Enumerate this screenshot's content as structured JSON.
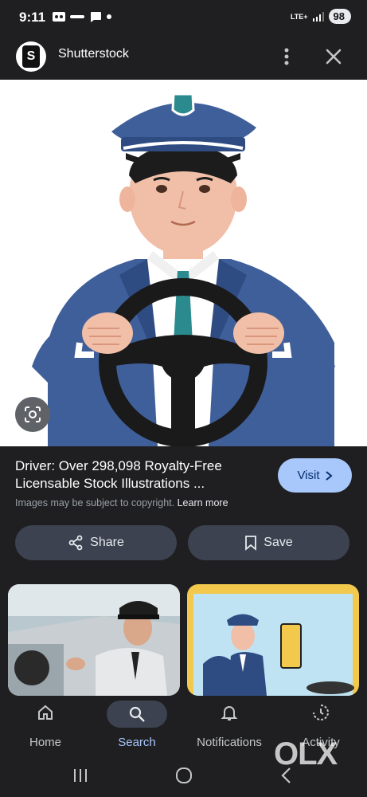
{
  "status_bar": {
    "time": "9:11",
    "network": "LTE+",
    "battery": "98"
  },
  "header": {
    "site_name": "Shutterstock",
    "logo_letter": "S"
  },
  "result": {
    "title": "Driver: Over 298,098 Royalty-Free Licensable Stock Illustrations ...",
    "copyright_text": "Images may be subject to copyright.",
    "learn_more": "Learn more",
    "visit_label": "Visit"
  },
  "actions": {
    "share_label": "Share",
    "save_label": "Save"
  },
  "bottom_nav": {
    "items": [
      {
        "label": "Home",
        "icon": "home-icon"
      },
      {
        "label": "Search",
        "icon": "search-icon"
      },
      {
        "label": "Notifications",
        "icon": "bell-icon"
      },
      {
        "label": "Activity",
        "icon": "activity-icon"
      }
    ]
  },
  "watermark": "OLX",
  "colors": {
    "background": "#1f1f21",
    "visit_button": "#a8c7fa",
    "pill_button": "#3c4250",
    "uniform_blue": "#3f5f9a"
  }
}
